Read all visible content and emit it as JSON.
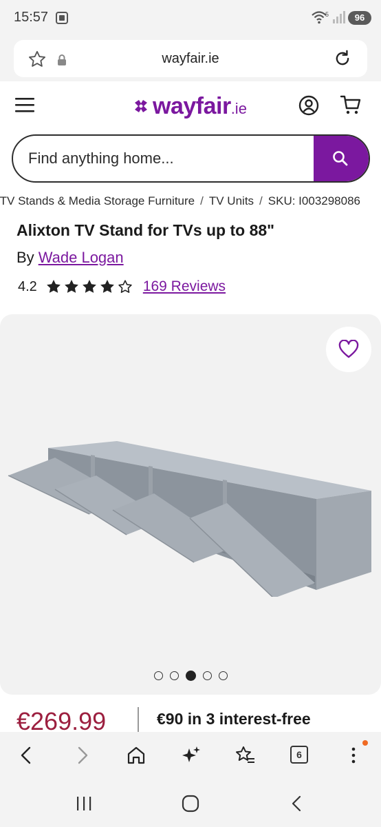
{
  "status": {
    "time": "15:57",
    "wifi_label": "5",
    "battery": "96"
  },
  "browser": {
    "url": "wayfair.ie"
  },
  "site": {
    "logo_word": "wayfair",
    "logo_tld": ".ie",
    "brand_color": "#7b189f"
  },
  "search": {
    "placeholder": "Find anything home..."
  },
  "breadcrumb": {
    "items": [
      "TV Stands & Media Storage Furniture",
      "TV Units",
      "SKU: I003298086"
    ]
  },
  "product": {
    "title": "Alixton TV Stand for TVs up to 88\"",
    "by_label": "By",
    "brand": "Wade Logan",
    "rating": "4.2",
    "stars_filled": 4,
    "stars_total": 5,
    "reviews_label": "169 Reviews",
    "price": "€269.99",
    "installment": "€90 in 3 interest-free",
    "price_color": "#9c1f3f"
  },
  "gallery": {
    "image_count": 5,
    "active_index": 2
  },
  "toolbar": {
    "tab_count": "6"
  },
  "icons": [
    "camera-screenshot-icon",
    "wifi-icon",
    "signal-icon",
    "star-outline-icon",
    "lock-icon",
    "reload-icon",
    "menu-icon",
    "account-icon",
    "cart-icon",
    "search-icon",
    "heart-icon",
    "back-icon",
    "forward-icon",
    "home-icon",
    "sparkle-icon",
    "bookmarks-icon",
    "tabs-icon",
    "more-icon",
    "recents-icon",
    "home-pill-icon",
    "nav-back-icon"
  ]
}
